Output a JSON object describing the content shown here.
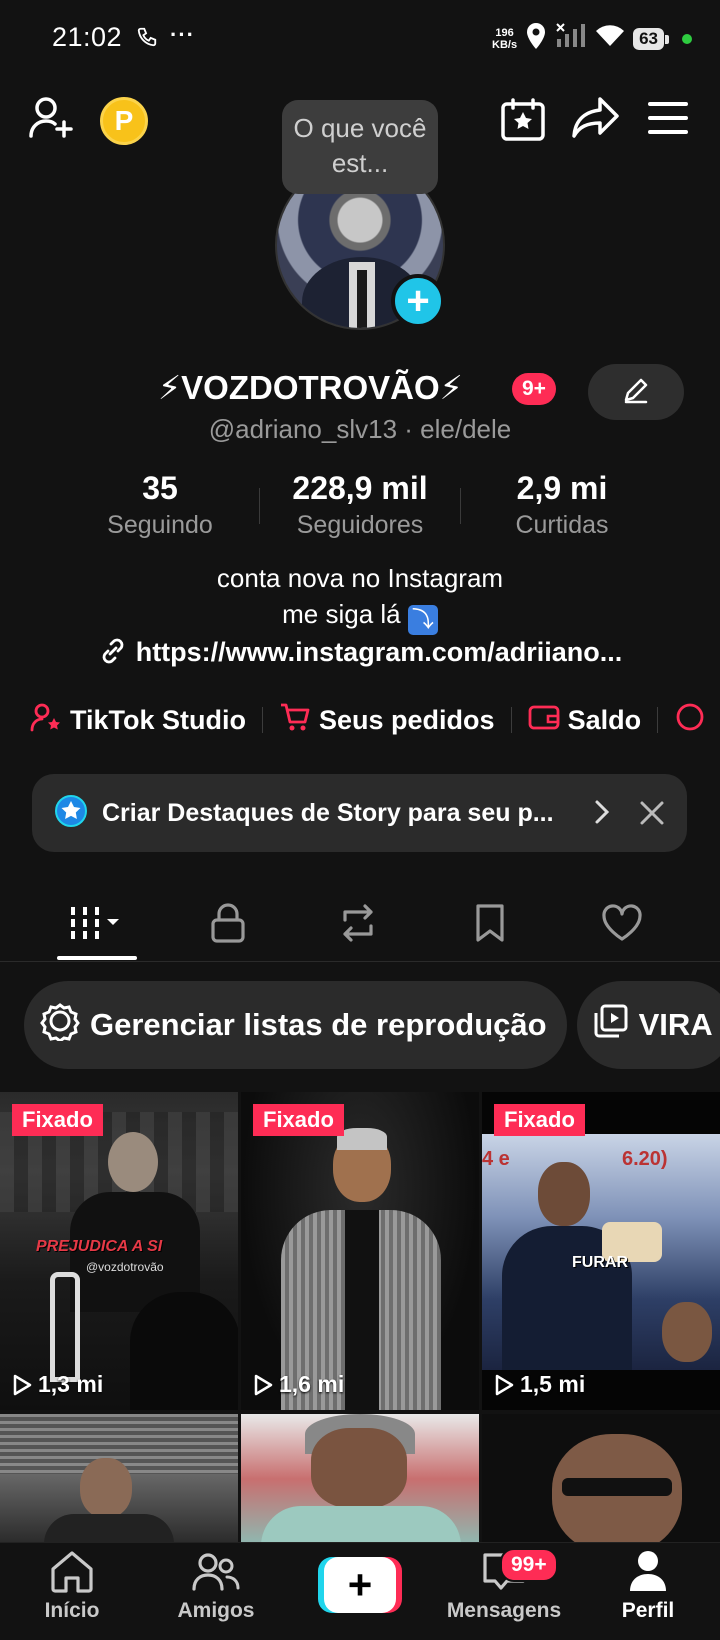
{
  "status_bar": {
    "time": "21:02",
    "dots": "···",
    "speed_value": "196",
    "speed_unit": "KB/s",
    "battery": "63",
    "icons": [
      "phone-icon",
      "location-icon",
      "signal-icon",
      "wifi-icon"
    ]
  },
  "header": {
    "tooltip": "O que você est...",
    "icons": [
      "add-friend-icon",
      "coin-icon",
      "calendar-star-icon",
      "share-icon",
      "menu-icon"
    ],
    "coin_label": "P"
  },
  "profile": {
    "name": "⚡VOZDOTROVÃO⚡",
    "notification_badge": "9+",
    "handle": "@adriano_slv13 · ele/dele",
    "stats": [
      {
        "value": "35",
        "label": "Seguindo"
      },
      {
        "value": "228,9 mil",
        "label": "Seguidores"
      },
      {
        "value": "2,9 mi",
        "label": "Curtidas"
      }
    ],
    "bio_line1": "conta nova no Instagram",
    "bio_line2": "me siga lá",
    "bio_emoji": "⤵",
    "link": "https://www.instagram.com/adriiano..."
  },
  "tools": [
    {
      "label": "TikTok Studio",
      "icon": "person-star-icon"
    },
    {
      "label": "Seus pedidos",
      "icon": "cart-icon"
    },
    {
      "label": "Saldo",
      "icon": "wallet-icon"
    }
  ],
  "story_banner": {
    "text": "Criar Destaques de Story para seu p..."
  },
  "tabs": [
    "videos-grid-icon",
    "lock-icon",
    "repost-icon",
    "bookmark-icon",
    "heart-icon"
  ],
  "chips": [
    {
      "label": "Gerenciar listas de reprodução",
      "icon": "gear-icon"
    },
    {
      "label": "VIRA",
      "icon": "playlist-icon"
    }
  ],
  "videos": [
    {
      "pinned": "Fixado",
      "views": "1,3 mi",
      "overlay": "PREJUDICA A SI",
      "overlay_handle": "@vozdotrovão"
    },
    {
      "pinned": "Fixado",
      "views": "1,6 mi"
    },
    {
      "pinned": "Fixado",
      "views": "1,5 mi",
      "overlay": "FURAR",
      "overlay_top": "4 e",
      "overlay_top2": "6.20)"
    }
  ],
  "bottom_nav": {
    "items": [
      {
        "label": "Início",
        "icon": "home-icon"
      },
      {
        "label": "Amigos",
        "icon": "friends-icon"
      },
      {
        "label": "",
        "icon": "plus-icon"
      },
      {
        "label": "Mensagens",
        "icon": "message-icon"
      },
      {
        "label": "Perfil",
        "icon": "profile-icon"
      }
    ],
    "messages_badge": "99+",
    "plus_label": "+"
  },
  "colors": {
    "accent": "#fe2c55",
    "cyan": "#20c5e8",
    "background": "#121212"
  }
}
